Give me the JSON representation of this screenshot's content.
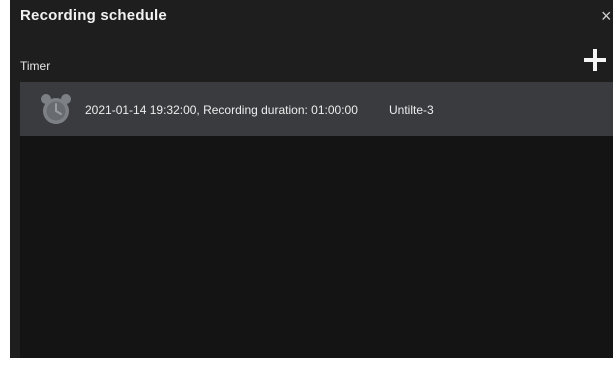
{
  "dialog": {
    "title": "Recording schedule",
    "close_glyph": "×",
    "section_label": "Timer",
    "add_icon": "plus-icon"
  },
  "timers": [
    {
      "icon": "alarm-clock-icon",
      "description": "2021-01-14 19:32:00, Recording duration: 01:00:00",
      "name": "Untilte-3"
    }
  ],
  "colors": {
    "dialog_background": "#1e1e1e",
    "list_background": "#141414",
    "item_background": "#3a3b3f",
    "text": "#ededed"
  }
}
